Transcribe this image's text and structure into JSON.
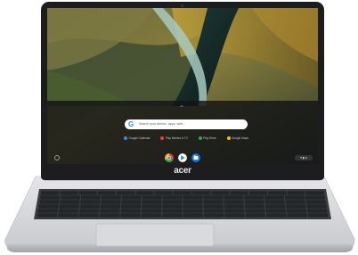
{
  "screen": {
    "search_placeholder": "Search your device, apps, web...",
    "suggestions": [
      {
        "label": "Google Calendar",
        "color": "#4285f4"
      },
      {
        "label": "Play Movies & TV",
        "color": "#ea4335"
      },
      {
        "label": "Play Store",
        "color": "#34a853"
      },
      {
        "label": "Google Maps",
        "color": "#fbbc05"
      }
    ],
    "shelf_apps": [
      {
        "icon": "chrome-icon",
        "color": "#ea4335"
      },
      {
        "icon": "play-store-icon",
        "color": "#34a853"
      },
      {
        "icon": "files-icon",
        "color": "#1a73e8"
      }
    ],
    "status_area": "▾ ▮ ●"
  },
  "brand": {
    "logo_text": "acer",
    "color": "#e8e8e8"
  },
  "colors": {
    "bezel": "#1d1d1f",
    "chassis": "#d2d4d6",
    "keys": "#2a2c2f"
  }
}
